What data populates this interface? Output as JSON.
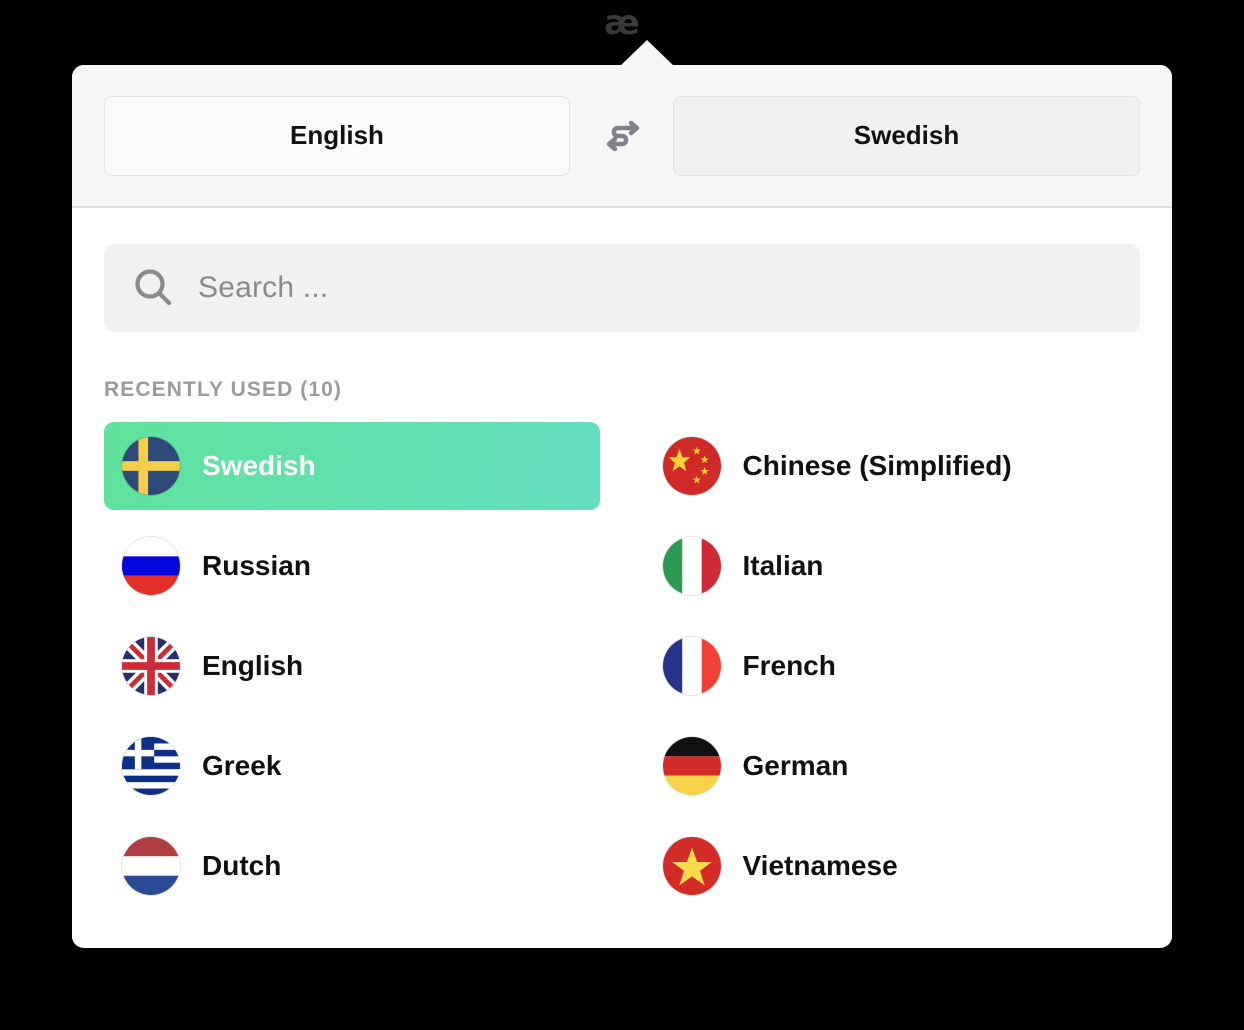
{
  "menubar": {
    "icon": "ae-ligature-icon",
    "glyph": "æ"
  },
  "header": {
    "source_language": "English",
    "target_language": "Swedish",
    "swap_icon": "swap-arrows-icon"
  },
  "search": {
    "icon": "search-icon",
    "placeholder": "Search ...",
    "value": ""
  },
  "section": {
    "label": "RECENTLY USED (10)",
    "count": 10
  },
  "colors": {
    "selected_gradient_start": "#5FE39B",
    "selected_gradient_end": "#62DEC0",
    "header_bg": "#F7F7F7",
    "search_bg": "#F1F1F1",
    "section_label": "#9A9AA0",
    "panel_bg": "#FFFFFF",
    "backdrop": "#000000"
  },
  "languages": [
    {
      "name": "Swedish",
      "flag": "flag-sweden",
      "selected": true
    },
    {
      "name": "Chinese (Simplified)",
      "flag": "flag-china",
      "selected": false
    },
    {
      "name": "Russian",
      "flag": "flag-russia",
      "selected": false
    },
    {
      "name": "Italian",
      "flag": "flag-italy",
      "selected": false
    },
    {
      "name": "English",
      "flag": "flag-uk",
      "selected": false
    },
    {
      "name": "French",
      "flag": "flag-france",
      "selected": false
    },
    {
      "name": "Greek",
      "flag": "flag-greece",
      "selected": false
    },
    {
      "name": "German",
      "flag": "flag-germany",
      "selected": false
    },
    {
      "name": "Dutch",
      "flag": "flag-netherlands",
      "selected": false
    },
    {
      "name": "Vietnamese",
      "flag": "flag-vietnam",
      "selected": false
    }
  ]
}
